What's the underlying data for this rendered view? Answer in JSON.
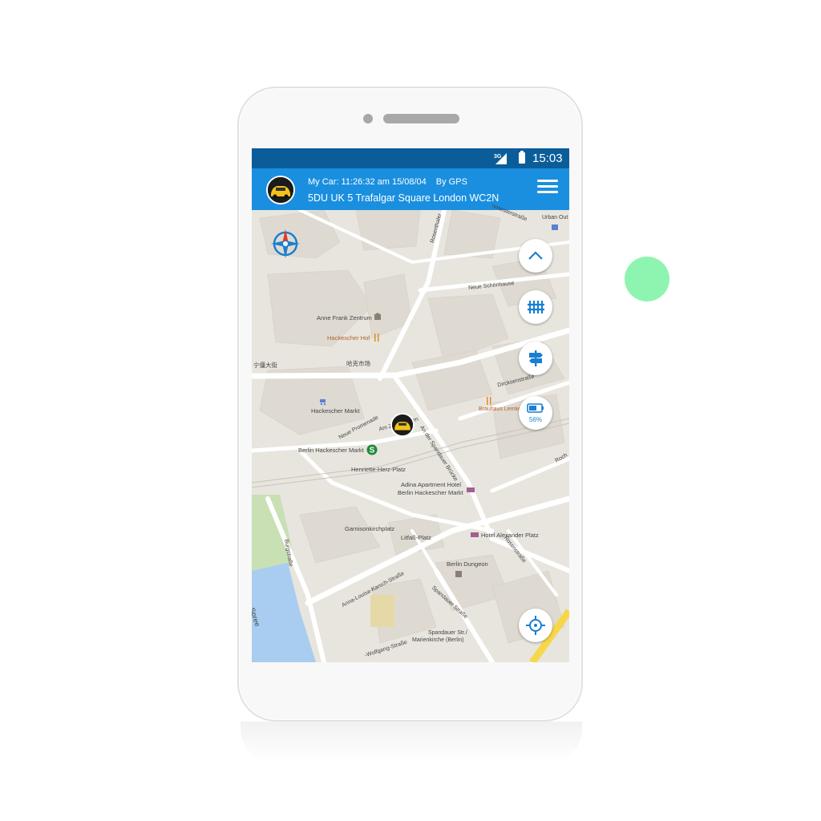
{
  "status_bar": {
    "network": "3G",
    "time": "15:03"
  },
  "app_bar": {
    "car_label": "My Car: 11:26:32 am 15/08/04",
    "source": "By GPS",
    "address": "5DU UK 5 Trafalgar Square London WC2N"
  },
  "map_controls": {
    "battery_percent": "56%"
  },
  "map_labels": {
    "anne_frank": "Anne Frank Zentrum",
    "hackescher_hof": "Hackescher Hof",
    "chinese_left": "宁僵大街",
    "chinese_mid": "哈克市场",
    "hackescher_markt": "Hackescher Markt",
    "neue_promenade": "Neue Promenade",
    "am_zwingt": "Am Zwingt...ben",
    "berlin_hackescher_markt": "Berlin Hackescher Markt",
    "henriette": "Henriette-Herz-Platz",
    "adina_1": "Adina Apartment Hotel",
    "adina_2": "Berlin Hackescher Markt",
    "garnison": "Garnisonkirchplatz",
    "litfass": "Litfaß-Platz",
    "hotel_alex": "Hotel Alexander Platz",
    "berlin_dungeon": "Berlin Dungeon",
    "spandauer_str": "Spandauer Str./",
    "marienkirche": "Marienkirche (Berlin)",
    "dircksen": "Dircksenstraße",
    "brauhaus": "Brauhaus Lemke",
    "an_der_spandauer": "An der Spandauer Brücke",
    "neue_schoenhauser": "Neue Schönhause",
    "rosenthaler": "Rosenthaler",
    "urban_outfitters": "Urban Out",
    "weinmeister": "nmeisterstraße",
    "burgstrasse": "Burgstraße",
    "anna_louisa": "Anna-Louisa-Karsch-Straße",
    "spandauer_strasse": "Spandauer Straße",
    "rosenstrasse": "Rosenstraße",
    "spree": "Spree",
    "wolfgang": "-Wolfgang-Straße",
    "rochstr": "Roch"
  },
  "colors": {
    "status_bar": "#0b5d9a",
    "app_bar": "#1a8fe0",
    "accent": "#1a7fd0",
    "deco_dot": "#8ef5b0"
  }
}
